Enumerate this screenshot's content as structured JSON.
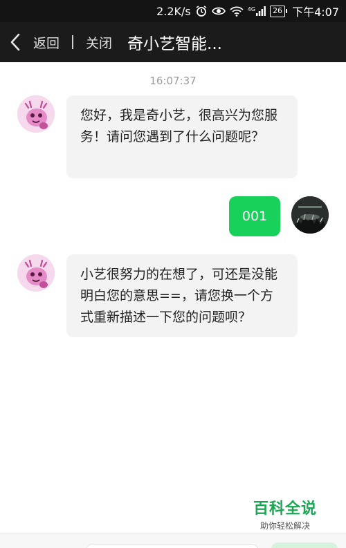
{
  "status_bar": {
    "speed": "2.2K/s",
    "network": "4G",
    "battery": "26",
    "time": "下午4:07"
  },
  "header": {
    "back_label": "返回",
    "close_label": "关闭",
    "title": "奇小艺智能..."
  },
  "chat": {
    "timestamp": "16:07:37",
    "messages": [
      {
        "from": "bot",
        "text": "您好，我是奇小艺，很高兴为您服务！请问您遇到了什么问题呢？"
      },
      {
        "from": "user",
        "text": "001"
      },
      {
        "from": "bot",
        "text": "小艺很努力的在想了，可还是没能明白您的意思==，请您换一个方式重新描述一下您的问题呗？"
      }
    ]
  },
  "watermark": {
    "title": "百科全说",
    "subtitle": "助你轻松解决"
  },
  "colors": {
    "user_bubble": "#17d15a",
    "bot_bubble": "#f3f3f3",
    "header_bg": "#1b1b1b",
    "watermark": "#1aa653"
  }
}
